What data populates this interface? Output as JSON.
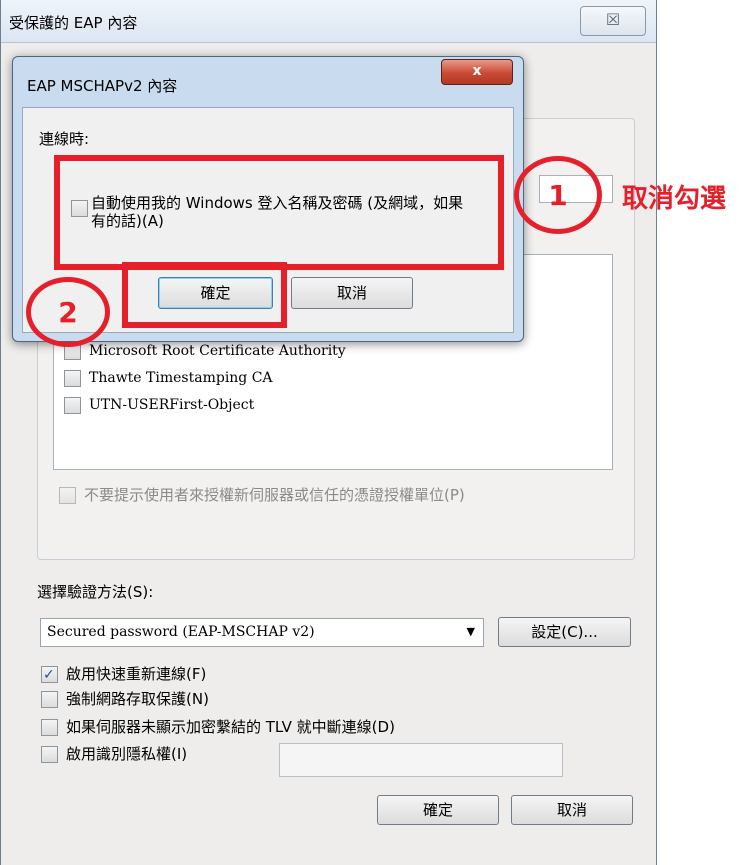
{
  "outer_dialog": {
    "title": "受保護的 EAP 內容",
    "close_glyph": "☒",
    "certificates": [
      {
        "label": "Microsoft Root Certificate Authority",
        "checked": false
      },
      {
        "label": "Thawte Timestamping CA",
        "checked": false
      },
      {
        "label": "UTN-USERFirst-Object",
        "checked": false
      }
    ],
    "dont_prompt_label": "不要提示使用者來授權新伺服器或信任的憑證授權單位(P)",
    "auth_method_label": "選擇驗證方法(S):",
    "auth_method_value": "Secured password (EAP-MSCHAP v2)",
    "configure_button": "設定(C)...",
    "options": [
      {
        "label": "啟用快速重新連線(F)",
        "checked": true
      },
      {
        "label": "強制網路存取保護(N)",
        "checked": false
      },
      {
        "label": "如果伺服器未顯示加密繫結的 TLV 就中斷連線(D)",
        "checked": false
      },
      {
        "label": "啟用識別隱私權(I)",
        "checked": false
      }
    ],
    "ok_button": "確定",
    "cancel_button": "取消"
  },
  "inner_dialog": {
    "title": "EAP MSCHAPv2 內容",
    "close_glyph": "x",
    "when_connecting_label": "連線時:",
    "auto_use_label": "自動使用我的 Windows 登入名稱及密碼 (及網域，如果有的話)(A)",
    "ok_button": "確定",
    "cancel_button": "取消"
  },
  "annotations": {
    "step1": "1",
    "step2": "2",
    "step1_text": "取消勾選",
    "color": "#e5202a"
  }
}
